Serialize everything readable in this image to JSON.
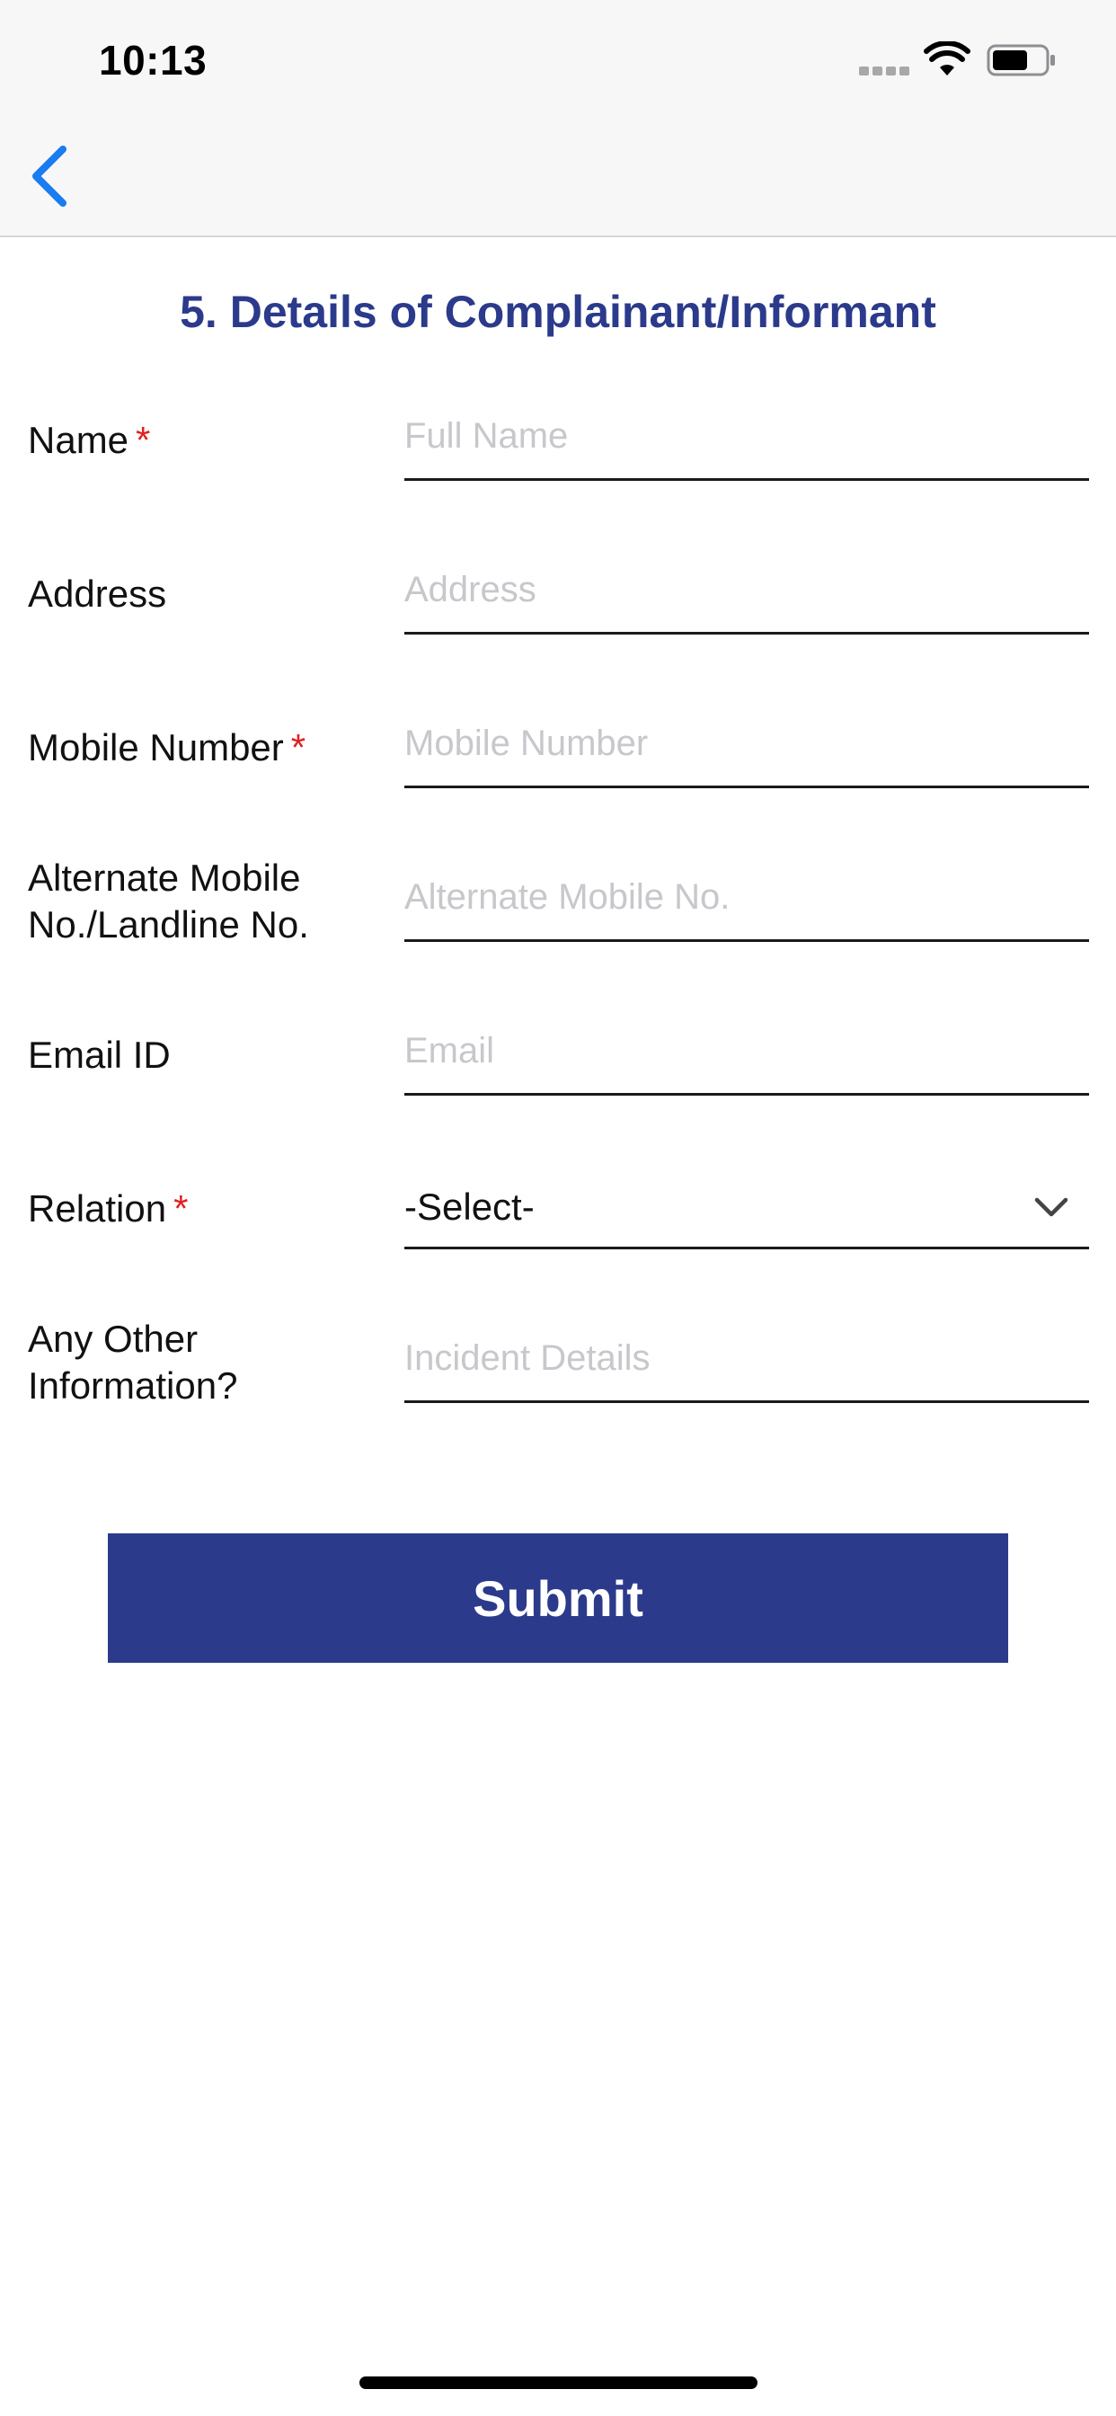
{
  "status_bar": {
    "time": "10:13"
  },
  "nav": {
    "back_icon": "chevron-left-icon"
  },
  "form": {
    "title": "5. Details of Complainant/Informant",
    "required_mark": "*",
    "fields": [
      {
        "label": "Name",
        "required": true,
        "placeholder": "Full Name",
        "value": ""
      },
      {
        "label": "Address",
        "required": false,
        "placeholder": "Address",
        "value": ""
      },
      {
        "label": "Mobile Number",
        "required": true,
        "placeholder": "Mobile Number",
        "value": ""
      },
      {
        "label": "Alternate Mobile No./Landline No.",
        "required": false,
        "placeholder": "Alternate Mobile No.",
        "value": ""
      },
      {
        "label": "Email ID",
        "required": false,
        "placeholder": "Email",
        "value": ""
      }
    ],
    "relation": {
      "label": "Relation",
      "required": true,
      "selected": "-Select-"
    },
    "other_info": {
      "label": "Any Other Information?",
      "required": false,
      "placeholder": "Incident Details",
      "value": ""
    },
    "submit_label": "Submit"
  },
  "colors": {
    "accent": "#2b3a8b",
    "required": "#e02020",
    "back_icon": "#1a7cf0",
    "placeholder": "#c7c7cc"
  }
}
